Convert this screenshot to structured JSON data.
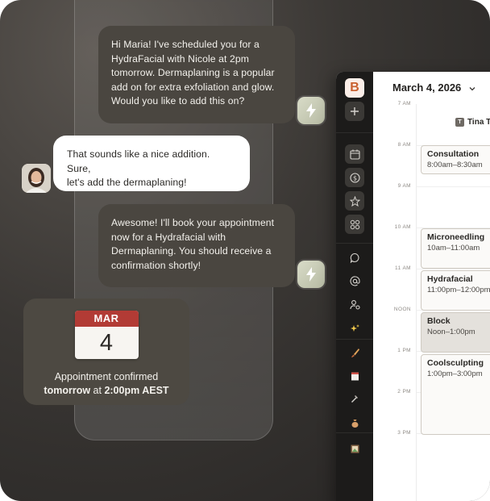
{
  "chat": {
    "messages": [
      {
        "from": "ai",
        "text": "Hi Maria! I've scheduled you for a\nHydraFacial with Nicole at 2pm\ntomorrow. Dermaplaning is a popular\nadd on for extra exfoliation and glow.\nWould you like to add this on?"
      },
      {
        "from": "user",
        "text": "That sounds like a nice addition. Sure,\nlet's add the dermaplaning!"
      },
      {
        "from": "ai",
        "text": "Awesome! I'll book your appointment\nnow for a Hydrafacial with\nDermaplaning. You should receive a\nconfirmation shortly!"
      }
    ],
    "confirmation": {
      "month": "MAR",
      "day": "4",
      "line1": "Appointment confirmed",
      "line2_bold_a": "tomorrow",
      "line2_mid": " at ",
      "line2_bold_b": "2:00pm AEST"
    }
  },
  "app": {
    "logo": "B",
    "date_title": "March 4, 2026",
    "staff": {
      "initial": "T",
      "name": "Tina T"
    },
    "time_labels": [
      "7 AM",
      "8 AM",
      "9 AM",
      "10 AM",
      "11 AM",
      "NOON",
      "1 PM",
      "2 PM",
      "3 PM"
    ],
    "appointments": [
      {
        "name": "Consultation",
        "time": "8:00am–8:30am"
      },
      {
        "name": "Microneedling",
        "time": "10am–11:00am"
      },
      {
        "name": "Hydrafacial",
        "time": "11:00pm–12:00pm"
      },
      {
        "name": "Block",
        "time": "Noon–1:00pm"
      },
      {
        "name": "Coolsculpting",
        "time": "1:00pm–3:00pm"
      }
    ],
    "sidebar_icons": [
      "add-icon",
      "calendar-icon",
      "dollar-icon",
      "star-icon",
      "apps-grid-icon",
      "chat-icon",
      "at-sign-icon",
      "user-settings-icon",
      "sparkles-icon",
      "brush-icon",
      "notepad-icon",
      "hammer-icon",
      "money-bag-icon",
      "framed-picture-icon"
    ]
  },
  "colors": {
    "accent_red": "#b23b35",
    "bolt_green": "#c7cbb4",
    "ai_bubble": "#4a4640"
  }
}
